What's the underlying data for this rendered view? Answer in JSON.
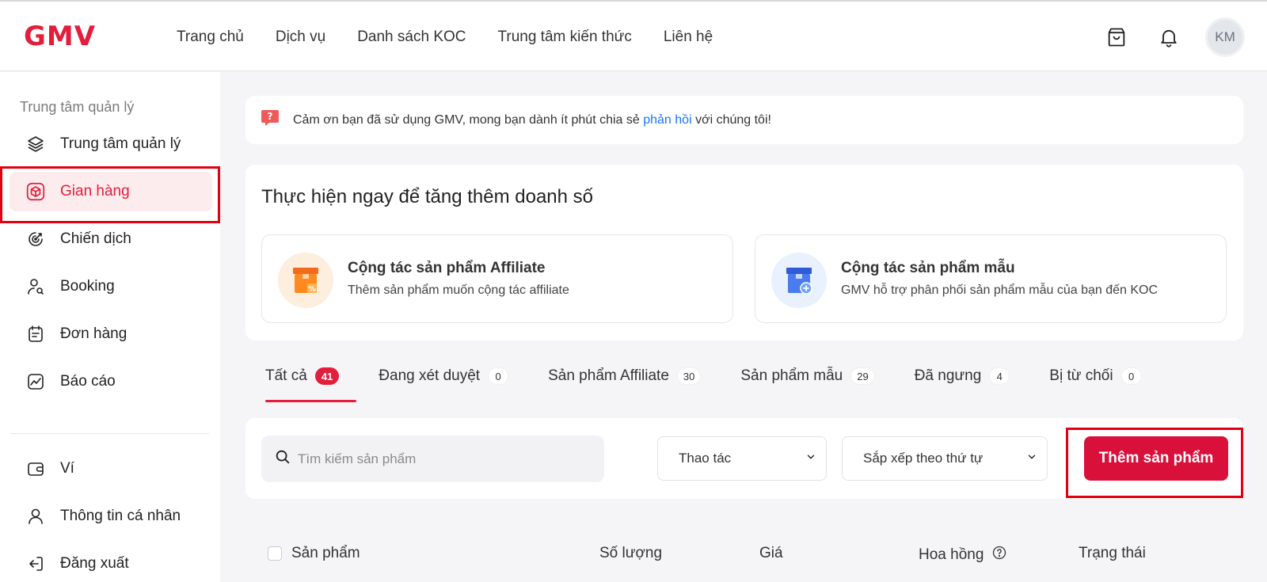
{
  "header": {
    "logo": "GMV",
    "nav": [
      "Trang chủ",
      "Dịch vụ",
      "Danh sách KOC",
      "Trung tâm kiến thức",
      "Liên hệ"
    ],
    "icons": [
      "shopping-bag-icon",
      "bell-icon"
    ],
    "avatar_initials": "KM"
  },
  "sidebar": {
    "heading": "Trung tâm quản lý",
    "items": [
      {
        "label": "Trung tâm quản lý",
        "icon": "layers-icon"
      },
      {
        "label": "Gian hàng",
        "icon": "box-icon",
        "active": true
      },
      {
        "label": "Chiến dịch",
        "icon": "target-icon"
      },
      {
        "label": "Booking",
        "icon": "user-search-icon"
      },
      {
        "label": "Đơn hàng",
        "icon": "calendar-list-icon"
      },
      {
        "label": "Báo cáo",
        "icon": "chart-icon"
      },
      {
        "label": "Ví",
        "icon": "wallet-icon"
      },
      {
        "label": "Thông tin cá nhân",
        "icon": "user-icon"
      },
      {
        "label": "Đăng xuất",
        "icon": "logout-icon"
      }
    ]
  },
  "feedback": {
    "text_before": "Cảm ơn bạn đã sử dụng GMV, mong bạn dành ít phút chia sẻ",
    "link": "phản hồi",
    "text_after": "với chúng tôi!"
  },
  "promo": {
    "title": "Thực hiện ngay để tăng thêm doanh số",
    "cards": [
      {
        "title": "Cộng tác sản phẩm Affiliate",
        "desc": "Thêm sản phẩm muốn cộng tác affiliate"
      },
      {
        "title": "Cộng tác sản phẩm mẫu",
        "desc": "GMV hỗ trợ phân phối sản phẩm mẫu của bạn đến KOC"
      }
    ]
  },
  "tabs": [
    {
      "label": "Tất cả",
      "count": "41",
      "active": true
    },
    {
      "label": "Đang xét duyệt",
      "count": "0"
    },
    {
      "label": "Sản phẩm Affiliate",
      "count": "30"
    },
    {
      "label": "Sản phẩm mẫu",
      "count": "29"
    },
    {
      "label": "Đã ngưng",
      "count": "4"
    },
    {
      "label": "Bị từ chối",
      "count": "0"
    }
  ],
  "toolbar": {
    "search_placeholder": "Tìm kiếm sản phẩm",
    "action_select": "Thao tác",
    "sort_select": "Sắp xếp theo thứ tự",
    "add_button": "Thêm sản phẩm"
  },
  "table": {
    "columns": [
      "Sản phẩm",
      "Số lượng",
      "Giá",
      "Hoa hồng",
      "Trạng thái"
    ]
  },
  "colors": {
    "brand": "#e31e3c",
    "button": "#d8103a",
    "link": "#1677ff"
  }
}
